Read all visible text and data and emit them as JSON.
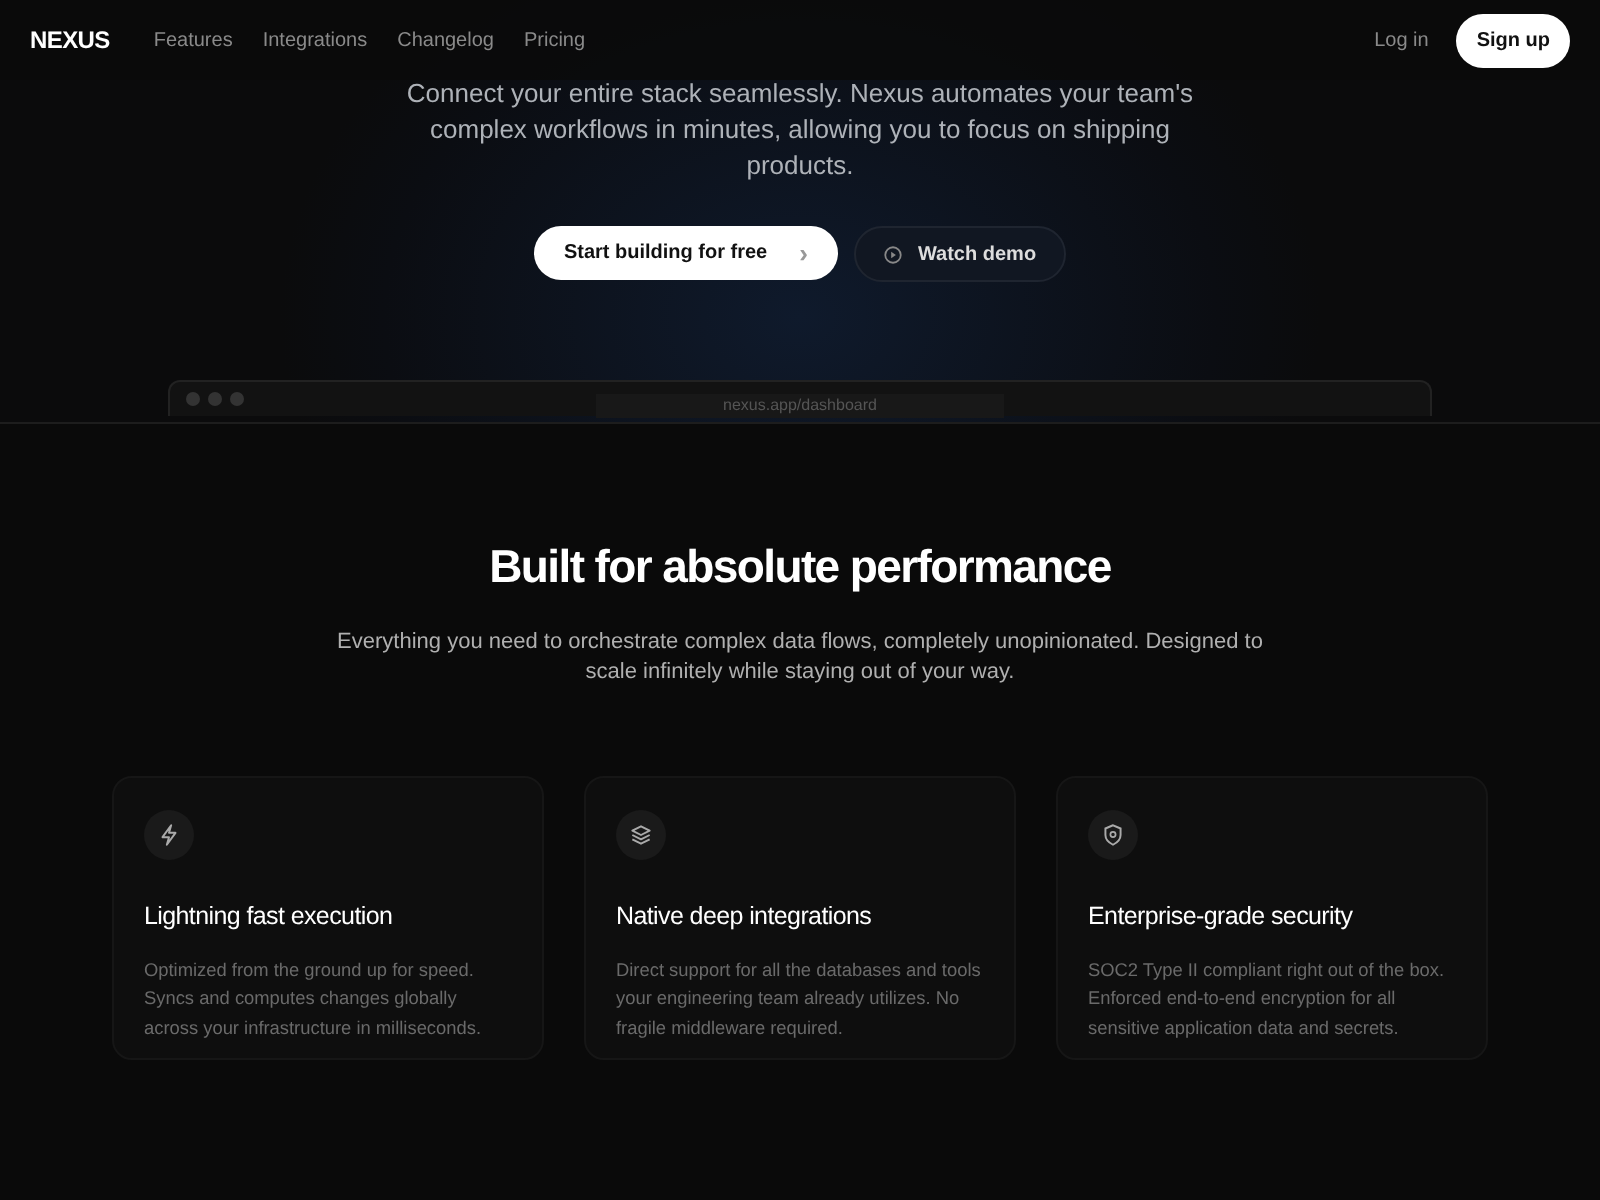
{
  "navbar": {
    "brand": "NEXUS",
    "links": [
      "Features",
      "Integrations",
      "Changelog",
      "Pricing"
    ],
    "login": "Log in",
    "signup": "Sign up"
  },
  "hero": {
    "description_lines": [
      "Connect your entire stack seamlessly. Nexus automates your team's",
      "complex workflows in minutes, allowing you to focus on shipping",
      "products."
    ],
    "primary_button": {
      "label": "Start building for free",
      "icon": "›"
    },
    "secondary_button": {
      "label": "Watch demo"
    },
    "preview": {
      "url": "nexus.app/dashboard"
    }
  },
  "features": {
    "title": "Built for absolute performance",
    "subtitle": "Everything you need to orchestrate complex data flows, completely unopinionated. Designed to scale infinitely while staying out of your way.",
    "cards": [
      {
        "title": "Lightning fast execution",
        "text": "Optimized from the ground up for speed. Syncs and computes changes globally across your infrastructure in milliseconds."
      },
      {
        "title": "Native deep integrations",
        "text": "Direct support for all the databases and tools your engineering team already utilizes. No fragile middleware required."
      },
      {
        "title": "Enterprise-grade security",
        "text": "SOC2 Type II compliant right out of the box. Enforced end-to-end encryption for all sensitive application data and secrets."
      }
    ]
  }
}
